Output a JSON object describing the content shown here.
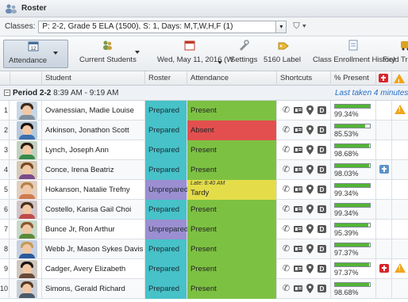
{
  "window": {
    "title": "Roster"
  },
  "classes": {
    "label": "Classes:",
    "selected": "P: 2-2, Grade 5 ELA (1500), S: 1, Days: M,T,W,H,F (1)",
    "dropdown_icon": "chevron-down-icon",
    "filter_icon": "filter-icon"
  },
  "toolbar": {
    "attendance": "Attendance",
    "current_students": "Current Students",
    "date": "Wed, May 11, 2016 (W",
    "settings": "Settings",
    "label_5160": "5160 Label",
    "enrollment_history": "Class Enrollment History",
    "field_trip": "Field Trip("
  },
  "columns": {
    "student": "Student",
    "roster_code": "Roster Code",
    "attendance": "Attendance",
    "shortcuts": "Shortcuts",
    "percent_present": "% Present"
  },
  "period": {
    "name": "Period 2-2",
    "time": "8:39 AM - 9:19 AM",
    "last_taken": "Last taken 4 minutes a"
  },
  "colors": {
    "prepared": "#46c2c8",
    "unprepared": "#9b8ed1",
    "present": "#7dc142",
    "absent": "#e34f4f",
    "tardy": "#e4dd49",
    "progress": "#54b435"
  },
  "students": [
    {
      "num": "1",
      "name": "Ovanessian, Madie Louise",
      "code": "Prepared",
      "attendance": "Present",
      "late": "",
      "pct": "99.34%",
      "pct_value": 99.34,
      "medical": "",
      "alert": true
    },
    {
      "num": "2",
      "name": "Arkinson, Jonathon Scott",
      "code": "Prepared",
      "attendance": "Absent",
      "late": "",
      "pct": "85.53%",
      "pct_value": 85.53,
      "medical": "",
      "alert": false
    },
    {
      "num": "3",
      "name": "Lynch, Joseph Ann",
      "code": "Prepared",
      "attendance": "Present",
      "late": "",
      "pct": "98.68%",
      "pct_value": 98.68,
      "medical": "",
      "alert": false
    },
    {
      "num": "4",
      "name": "Conce, Irena Beatriz",
      "code": "Prepared",
      "attendance": "Present",
      "late": "",
      "pct": "98.03%",
      "pct_value": 98.03,
      "medical": "blue",
      "alert": false
    },
    {
      "num": "5",
      "name": "Hokanson, Natalie Trefny",
      "code": "Unprepared",
      "attendance": "Tardy",
      "late": "Late: 8:40 AM",
      "pct": "99.34%",
      "pct_value": 99.34,
      "medical": "",
      "alert": false
    },
    {
      "num": "6",
      "name": "Costello, Karisa Gail Choi",
      "code": "Prepared",
      "attendance": "Present",
      "late": "",
      "pct": "99.34%",
      "pct_value": 99.34,
      "medical": "",
      "alert": false
    },
    {
      "num": "7",
      "name": "Bunce Jr, Ron Arthur",
      "code": "Unprepared",
      "attendance": "Present",
      "late": "",
      "pct": "95.39%",
      "pct_value": 95.39,
      "medical": "",
      "alert": false
    },
    {
      "num": "8",
      "name": "Webb Jr, Mason Sykes Davis",
      "code": "Prepared",
      "attendance": "Present",
      "late": "",
      "pct": "97.37%",
      "pct_value": 97.37,
      "medical": "",
      "alert": false
    },
    {
      "num": "9",
      "name": "Cadger, Avery Elizabeth",
      "code": "Prepared",
      "attendance": "Present",
      "late": "",
      "pct": "97.37%",
      "pct_value": 97.37,
      "medical": "red",
      "alert": true
    },
    {
      "num": "10",
      "name": "Simons, Gerald Richard",
      "code": "Prepared",
      "attendance": "Present",
      "late": "",
      "pct": "98.68%",
      "pct_value": 98.68,
      "medical": "",
      "alert": false
    }
  ]
}
